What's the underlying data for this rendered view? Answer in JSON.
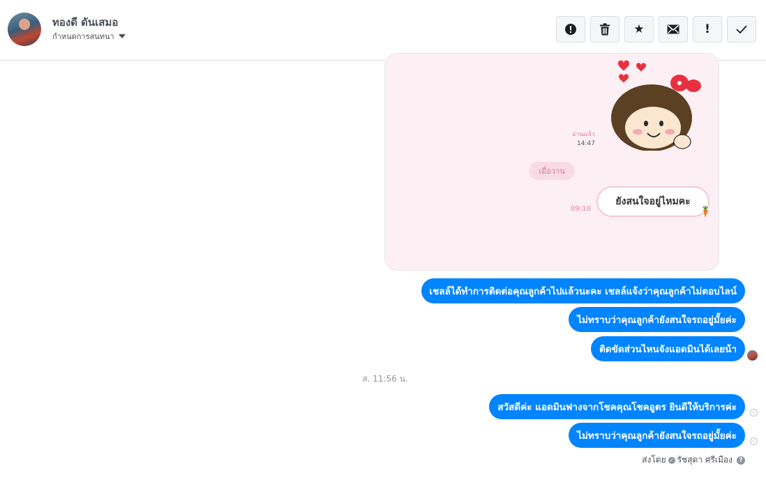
{
  "header": {
    "contact_name": "ทองดี ดันเสมอ",
    "label_menu": "กำหนดการสนทนา",
    "toolbar": [
      {
        "name": "report-button",
        "icon": "exclamation-circle-icon",
        "glyph": "!"
      },
      {
        "name": "delete-button",
        "icon": "trash-icon",
        "glyph": ""
      },
      {
        "name": "star-button",
        "icon": "star-icon",
        "glyph": "★"
      },
      {
        "name": "mark-unread-button",
        "icon": "envelope-icon",
        "glyph": "✉"
      },
      {
        "name": "follow-up-button",
        "icon": "exclamation-icon",
        "glyph": "!"
      },
      {
        "name": "mark-done-button",
        "icon": "check-icon",
        "glyph": "✓"
      }
    ]
  },
  "sticker_card": {
    "read_label": "อ่านแล้ว",
    "read_time": "14:47",
    "date_chip": "เมื่อวาน",
    "bubble_text": "ยังสนใจอยู่ไหมคะ",
    "bubble_time": "09:10"
  },
  "messages_before": [
    "เชลล์ได้ทำการติดต่อคุณลูกค้าไปแล้วนะคะ  เชลล์แจ้งว่าคุณลูกค้าไม่ตอบไลน์",
    "ไม่ทราบว่าคุณลูกค้ายังสนใจรถอยู่มั้ยค่ะ",
    "ติดขัดส่วนไหนจังแอดมินได้เลยน้า"
  ],
  "timestamp": "ส. 11:56 น.",
  "messages_after": [
    "สวัสดีค่ะ แอดมินฟางจากโชคคุณโชคอูตร ยินดีให้บริการค่ะ",
    "ไม่ทราบว่าคุณลูกค้ายังสนใจรถอยู่มั้ยค่ะ"
  ],
  "sent_by": {
    "prefix": "ส่งโดย",
    "name": "รัชสุดา ศรีเมือง"
  },
  "colors": {
    "bubble": "#0084ff",
    "sticker_bg": "#fdf0f4",
    "heart": "#e8313f"
  }
}
